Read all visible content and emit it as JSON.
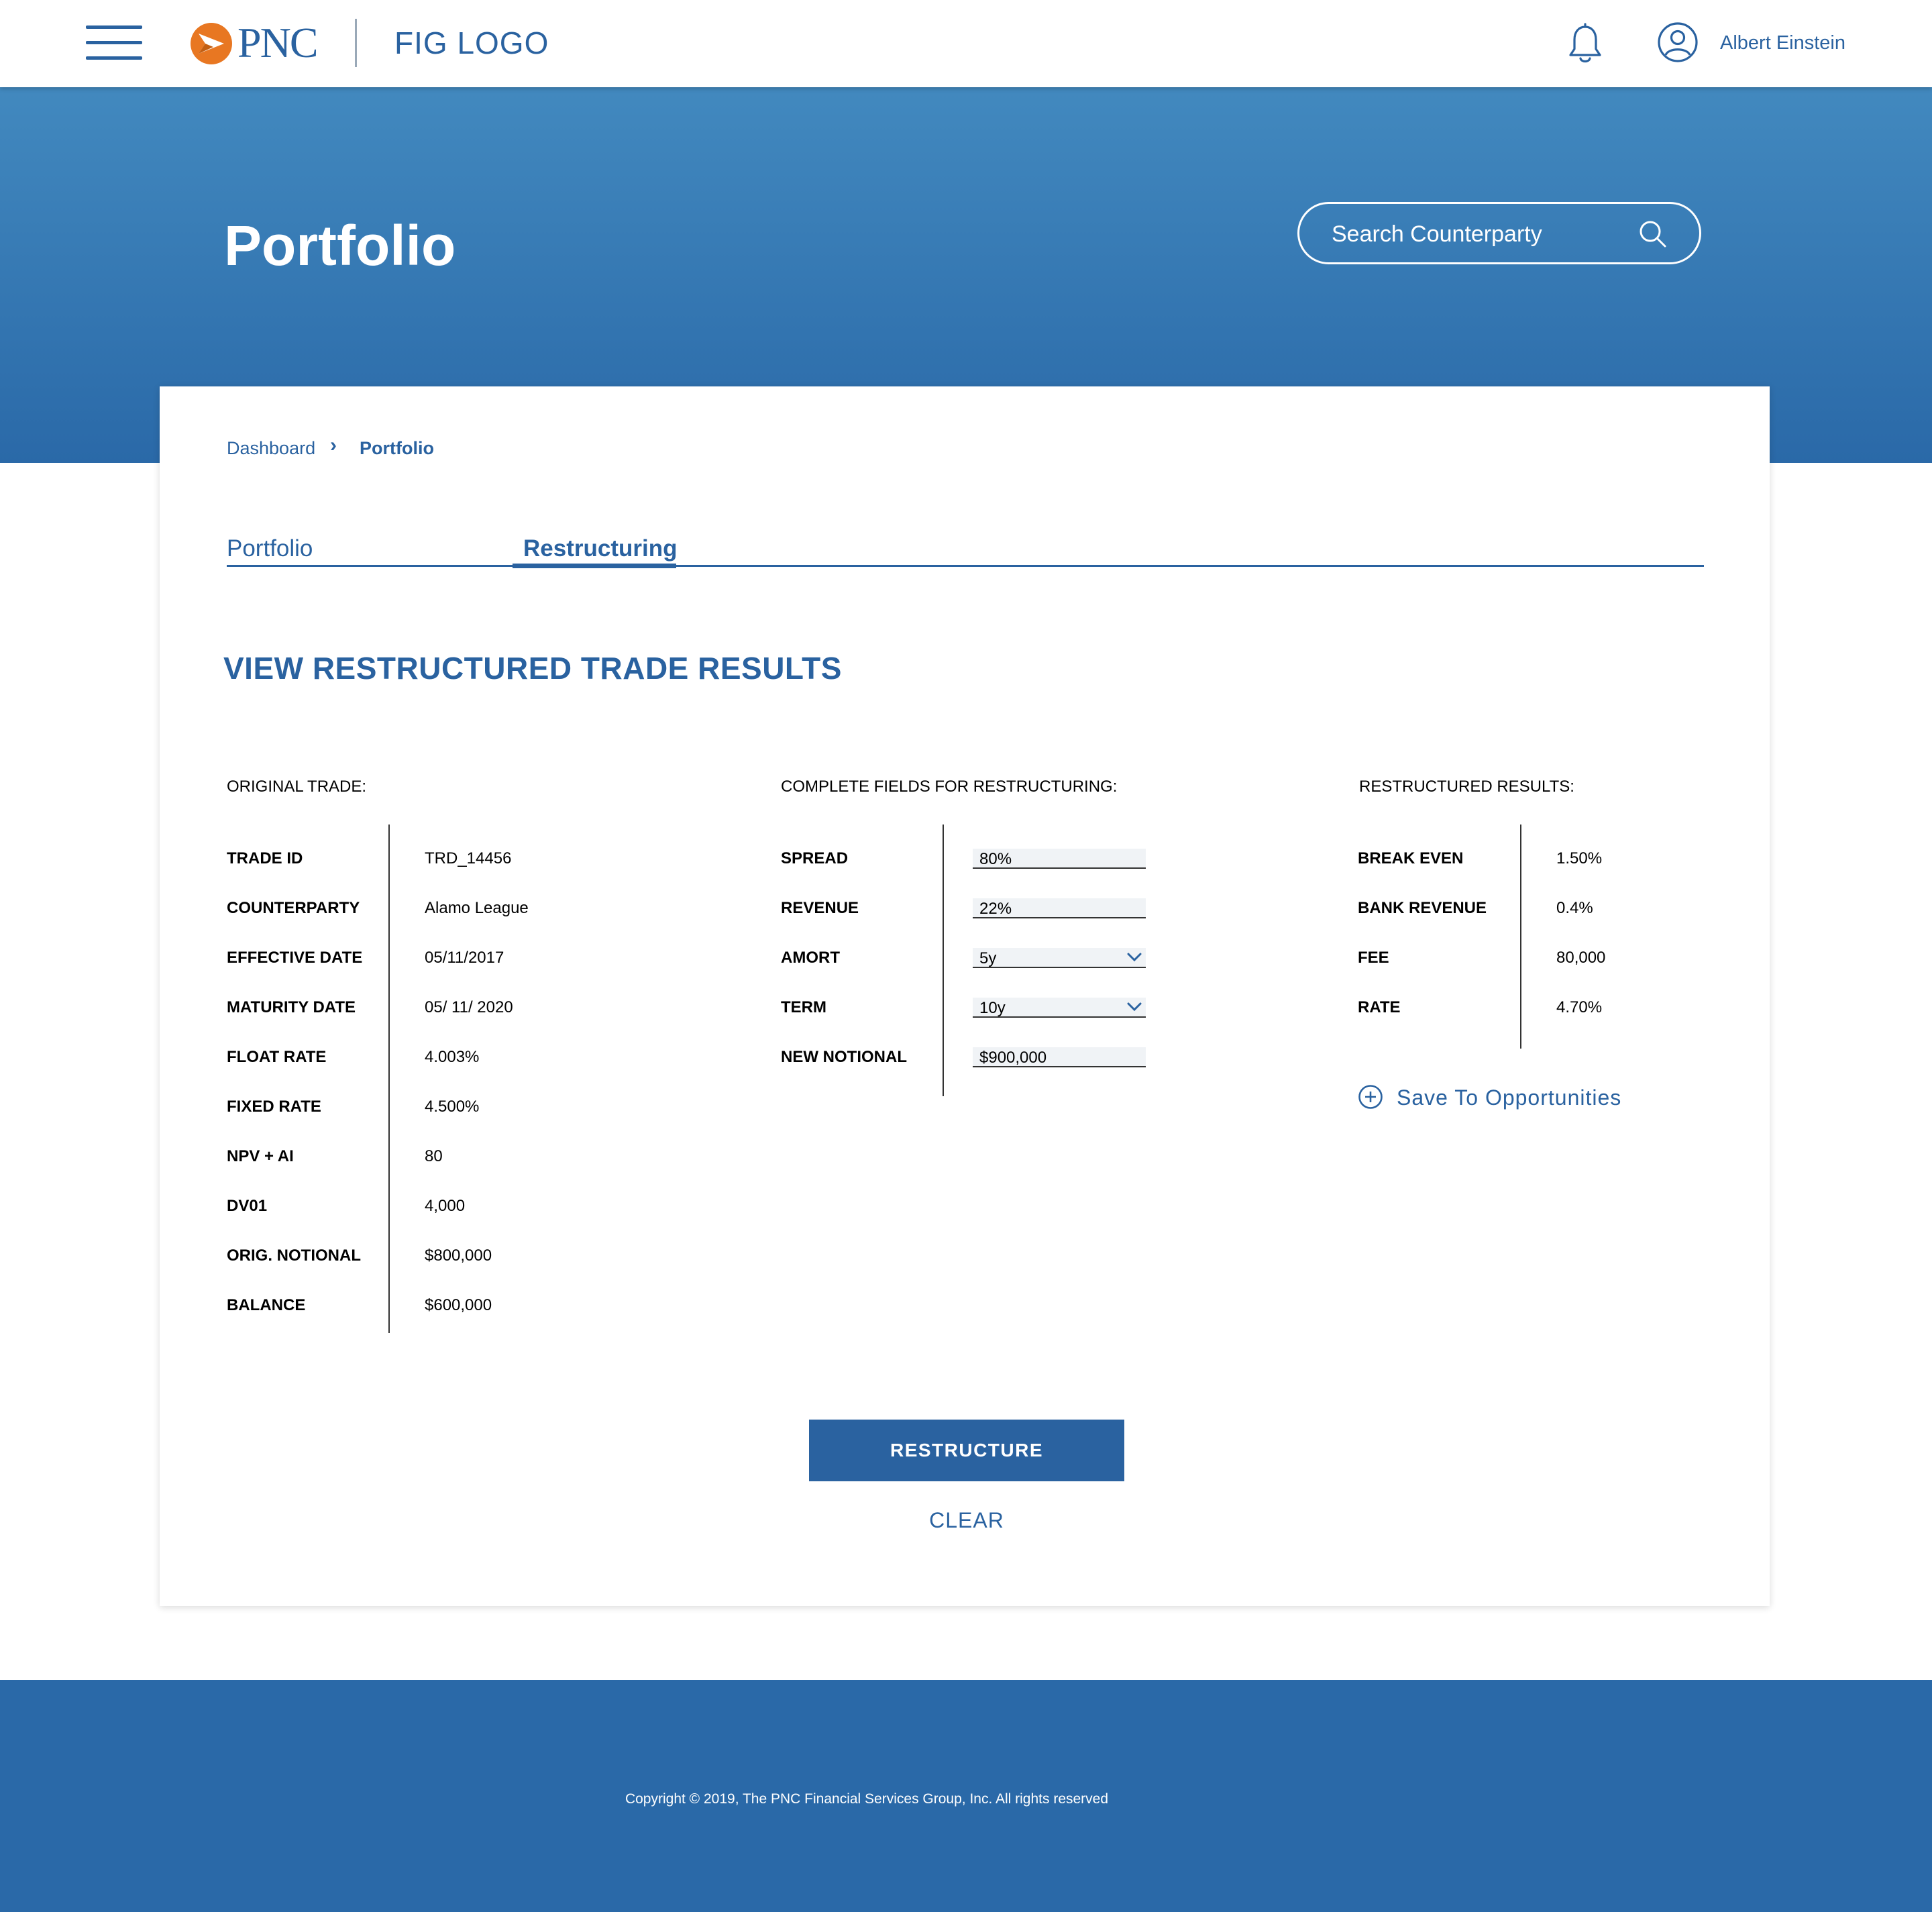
{
  "header": {
    "logo_text": "PNC",
    "fig_logo": "FIG LOGO",
    "user_name": "Albert Einstein",
    "icons": [
      "menu-icon",
      "pnc-logo-icon",
      "bell-icon",
      "user-icon"
    ]
  },
  "hero": {
    "title": "Portfolio",
    "search_placeholder": "Search Counterparty"
  },
  "breadcrumb": [
    "Dashboard",
    "Portfolio"
  ],
  "tabs": [
    {
      "label": "Portfolio",
      "active": false
    },
    {
      "label": "Restructuring",
      "active": true
    }
  ],
  "section_title": "VIEW RESTRUCTURED TRADE RESULTS",
  "original_trade": {
    "heading": "ORIGINAL TRADE:",
    "rows": [
      {
        "label": "TRADE ID",
        "value": "TRD_14456"
      },
      {
        "label": "COUNTERPARTY",
        "value": "Alamo League"
      },
      {
        "label": "EFFECTIVE DATE",
        "value": "05/11/2017"
      },
      {
        "label": "MATURITY DATE",
        "value": "05/ 11/ 2020"
      },
      {
        "label": "FLOAT RATE",
        "value": "4.003%"
      },
      {
        "label": "FIXED RATE",
        "value": "4.500%"
      },
      {
        "label": "NPV + AI",
        "value": "80"
      },
      {
        "label": "DV01",
        "value": "4,000"
      },
      {
        "label": "ORIG. NOTIONAL",
        "value": "$800,000"
      },
      {
        "label": "BALANCE",
        "value": "$600,000"
      }
    ]
  },
  "restructure_fields": {
    "heading": "COMPLETE FIELDS FOR RESTRUCTURING:",
    "rows": [
      {
        "label": "SPREAD",
        "value": "80%",
        "type": "text"
      },
      {
        "label": "REVENUE",
        "value": "22%",
        "type": "text"
      },
      {
        "label": "AMORT",
        "value": "5y",
        "type": "select"
      },
      {
        "label": "TERM",
        "value": "10y",
        "type": "select"
      },
      {
        "label": "NEW NOTIONAL",
        "value": "$900,000",
        "type": "text"
      }
    ]
  },
  "results": {
    "heading": "RESTRUCTURED RESULTS:",
    "rows": [
      {
        "label": "BREAK EVEN",
        "value": "1.50%"
      },
      {
        "label": "BANK REVENUE",
        "value": "0.4%"
      },
      {
        "label": "FEE",
        "value": "80,000"
      },
      {
        "label": "RATE",
        "value": "4.70%"
      }
    ],
    "save_label": "Save To Opportunities"
  },
  "actions": {
    "restructure_label": "RESTRUCTURE",
    "clear_label": "CLEAR"
  },
  "footer": {
    "copyright": "Copyright © 2019, The PNC Financial Services Group, Inc. All rights reserved"
  },
  "colors": {
    "brand_blue": "#2a62a0",
    "hero_top": "#4289bf",
    "hero_bottom": "#2a69a8",
    "pnc_orange": "#e87722"
  }
}
